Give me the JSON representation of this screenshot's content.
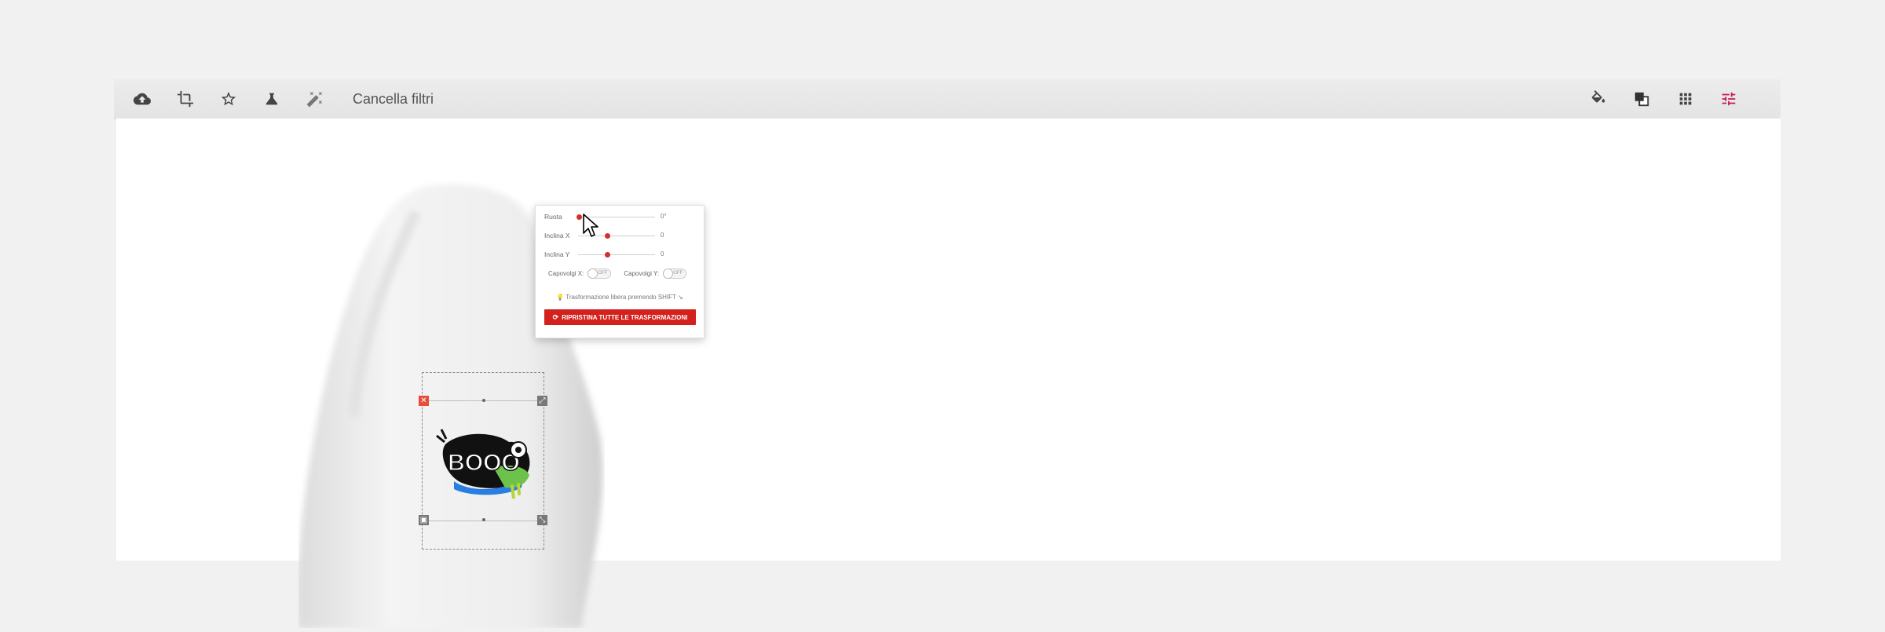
{
  "toolbar": {
    "left_icons": [
      "cloud-upload-icon",
      "crop-icon",
      "star-icon",
      "flask-icon",
      "magic-wand-icon"
    ],
    "clear_filters_label": "Cancella filtri",
    "right_icons": [
      "paint-bucket-icon",
      "layers-icon",
      "grid-icon",
      "sliders-icon"
    ],
    "active_color": "#c2185b"
  },
  "transform_panel": {
    "rotate": {
      "label": "Ruota",
      "value": "0°"
    },
    "skew_x": {
      "label": "Inclina X",
      "value": "0"
    },
    "skew_y": {
      "label": "Inclina Y",
      "value": "0"
    },
    "flip_x": {
      "label": "Capovolgi X:",
      "state": "OFF"
    },
    "flip_y": {
      "label": "Capovolgi Y:",
      "state": "OFF"
    },
    "hint": "Trasformazione libera premendo SHIFT",
    "reset_label": "RIPRISTINA TUTTE LE TRASFORMAZIONI",
    "accent": "#d3211d"
  },
  "design": {
    "artwork_text": "BOOO"
  }
}
